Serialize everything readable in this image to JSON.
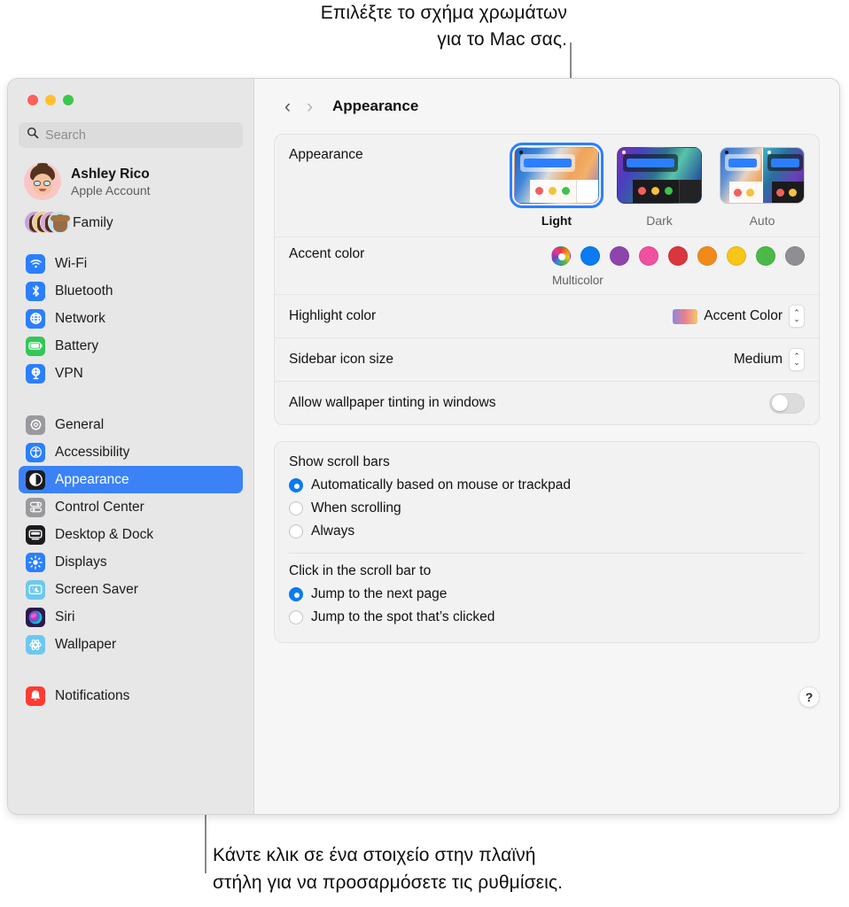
{
  "callouts": {
    "top_line1": "Επιλέξτε το σχήμα χρωμάτων",
    "top_line2": "για το Mac σας.",
    "bottom_line1": "Κάντε κλικ σε ένα στοιχείο στην πλαϊνή",
    "bottom_line2": "στήλη για να προσαρμόσετε τις ρυθμίσεις."
  },
  "window": {
    "traffic_lights": [
      "close",
      "minimize",
      "zoom"
    ]
  },
  "sidebar": {
    "search": {
      "placeholder": "Search",
      "icon": "search-icon"
    },
    "account": {
      "name": "Ashley Rico",
      "subtitle": "Apple Account",
      "avatar": "memoji-avatar"
    },
    "family": {
      "label": "Family",
      "icon": "family-avatars"
    },
    "groups": [
      {
        "items": [
          {
            "label": "Wi-Fi",
            "icon": "wifi-icon",
            "color": "#2b7fff",
            "selected": false
          },
          {
            "label": "Bluetooth",
            "icon": "bluetooth-icon",
            "color": "#2b7fff",
            "selected": false
          },
          {
            "label": "Network",
            "icon": "network-globe-icon",
            "color": "#2b7fff",
            "selected": false
          },
          {
            "label": "Battery",
            "icon": "battery-icon",
            "color": "#34c759",
            "selected": false
          },
          {
            "label": "VPN",
            "icon": "vpn-icon",
            "color": "#2b7fff",
            "selected": false
          }
        ]
      },
      {
        "items": [
          {
            "label": "General",
            "icon": "gear-icon",
            "color": "#9a9a9e",
            "selected": false
          },
          {
            "label": "Accessibility",
            "icon": "accessibility-icon",
            "color": "#2b7fff",
            "selected": false
          },
          {
            "label": "Appearance",
            "icon": "appearance-icon",
            "color": "#1c1c1e",
            "selected": true
          },
          {
            "label": "Control Center",
            "icon": "control-center-icon",
            "color": "#9a9a9e",
            "selected": false
          },
          {
            "label": "Desktop & Dock",
            "icon": "desktop-dock-icon",
            "color": "#1c1c1e",
            "selected": false
          },
          {
            "label": "Displays",
            "icon": "displays-icon",
            "color": "#2b7fff",
            "selected": false
          },
          {
            "label": "Screen Saver",
            "icon": "screen-saver-icon",
            "color": "#6cc8f0",
            "selected": false
          },
          {
            "label": "Siri",
            "icon": "siri-icon",
            "color": "#2b1a4a",
            "selected": false
          },
          {
            "label": "Wallpaper",
            "icon": "wallpaper-icon",
            "color": "#6cc8f0",
            "selected": false
          }
        ]
      },
      {
        "items": [
          {
            "label": "Notifications",
            "icon": "notifications-bell-icon",
            "color": "#ff3b30",
            "selected": false
          }
        ]
      }
    ]
  },
  "main": {
    "nav": {
      "back": "‹",
      "forward": "›"
    },
    "title": "Appearance",
    "appearance": {
      "label": "Appearance",
      "options": [
        {
          "name": "Light",
          "selected": true
        },
        {
          "name": "Dark",
          "selected": false
        },
        {
          "name": "Auto",
          "selected": false
        }
      ]
    },
    "accent": {
      "label": "Accent color",
      "selected_name": "Multicolor",
      "swatches": [
        {
          "name": "Multicolor",
          "color": "multicolor",
          "selected": true
        },
        {
          "name": "Blue",
          "color": "#0a7bf0",
          "selected": false
        },
        {
          "name": "Purple",
          "color": "#8e44ad",
          "selected": false
        },
        {
          "name": "Pink",
          "color": "#f0509e",
          "selected": false
        },
        {
          "name": "Red",
          "color": "#d9363e",
          "selected": false
        },
        {
          "name": "Orange",
          "color": "#ef8a1b",
          "selected": false
        },
        {
          "name": "Yellow",
          "color": "#f5c518",
          "selected": false
        },
        {
          "name": "Green",
          "color": "#4cb847",
          "selected": false
        },
        {
          "name": "Graphite",
          "color": "#8e8e93",
          "selected": false
        }
      ]
    },
    "highlight_color": {
      "label": "Highlight color",
      "value": "Accent Color"
    },
    "sidebar_icon_size": {
      "label": "Sidebar icon size",
      "value": "Medium"
    },
    "wallpaper_tinting": {
      "label": "Allow wallpaper tinting in windows",
      "enabled": false
    },
    "scroll_bars": {
      "heading": "Show scroll bars",
      "options": [
        {
          "label": "Automatically based on mouse or trackpad",
          "selected": true
        },
        {
          "label": "When scrolling",
          "selected": false
        },
        {
          "label": "Always",
          "selected": false
        }
      ]
    },
    "scroll_click": {
      "heading": "Click in the scroll bar to",
      "options": [
        {
          "label": "Jump to the next page",
          "selected": true
        },
        {
          "label": "Jump to the spot that’s clicked",
          "selected": false
        }
      ]
    },
    "help": {
      "label": "?"
    }
  }
}
